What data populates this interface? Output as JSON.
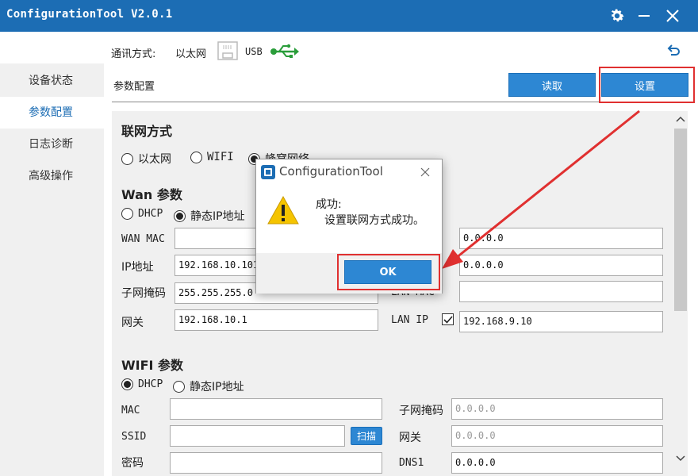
{
  "app": {
    "title": "ConfigurationTool V2.0.1"
  },
  "comm": {
    "label": "通讯方式:",
    "option_ethernet": "以太网",
    "option_usb": "USB"
  },
  "sidebar": {
    "items": [
      {
        "label": "设备状态"
      },
      {
        "label": "参数配置"
      },
      {
        "label": "日志诊断"
      },
      {
        "label": "高级操作"
      }
    ],
    "active_index": 1
  },
  "panel": {
    "title": "参数配置",
    "read_button": "读取",
    "set_button": "设置"
  },
  "network": {
    "title": "联网方式",
    "options": [
      "以太网",
      "WIFI",
      "蜂窝网络"
    ],
    "selected": "蜂窝网络"
  },
  "wan": {
    "title": "Wan 参数",
    "mode_dhcp": "DHCP",
    "mode_static": "静态IP地址",
    "selected": "静态IP地址",
    "mac_label": "WAN MAC",
    "mac_value": "",
    "ip_label": "IP地址",
    "ip_value": "192.168.10.101",
    "mask_label": "子网掩码",
    "mask_value": "255.255.255.0",
    "gw_label": "网关",
    "gw_value": "192.168.10.1",
    "right1_value": "0.0.0.0",
    "right2_value": "0.0.0.0",
    "lan_mac_label": "LAN MAC",
    "lan_mac_value": "",
    "lan_ip_label": "LAN IP",
    "lan_ip_checked": true,
    "lan_ip_value": "192.168.9.10"
  },
  "wifi": {
    "title": "WIFI 参数",
    "mode_dhcp": "DHCP",
    "mode_static": "静态IP地址",
    "selected": "DHCP",
    "mac_label": "MAC",
    "mac_value": "",
    "ssid_label": "SSID",
    "ssid_value": "",
    "scan_button": "扫描",
    "pwd_label": "密码",
    "mask_label": "子网掩码",
    "mask_value": "0.0.0.0",
    "gw_label": "网关",
    "gw_value": "0.0.0.0",
    "dns1_label": "DNS1",
    "dns1_value": "0.0.0.0"
  },
  "dialog": {
    "title": "ConfigurationTool",
    "heading": "成功:",
    "message": "设置联网方式成功。",
    "ok_button": "OK"
  },
  "colors": {
    "accent": "#1c6db4",
    "button": "#2d87d3",
    "highlight": "#e03030",
    "usb_icon": "#2a9d3a",
    "warning": "#f5c400"
  }
}
